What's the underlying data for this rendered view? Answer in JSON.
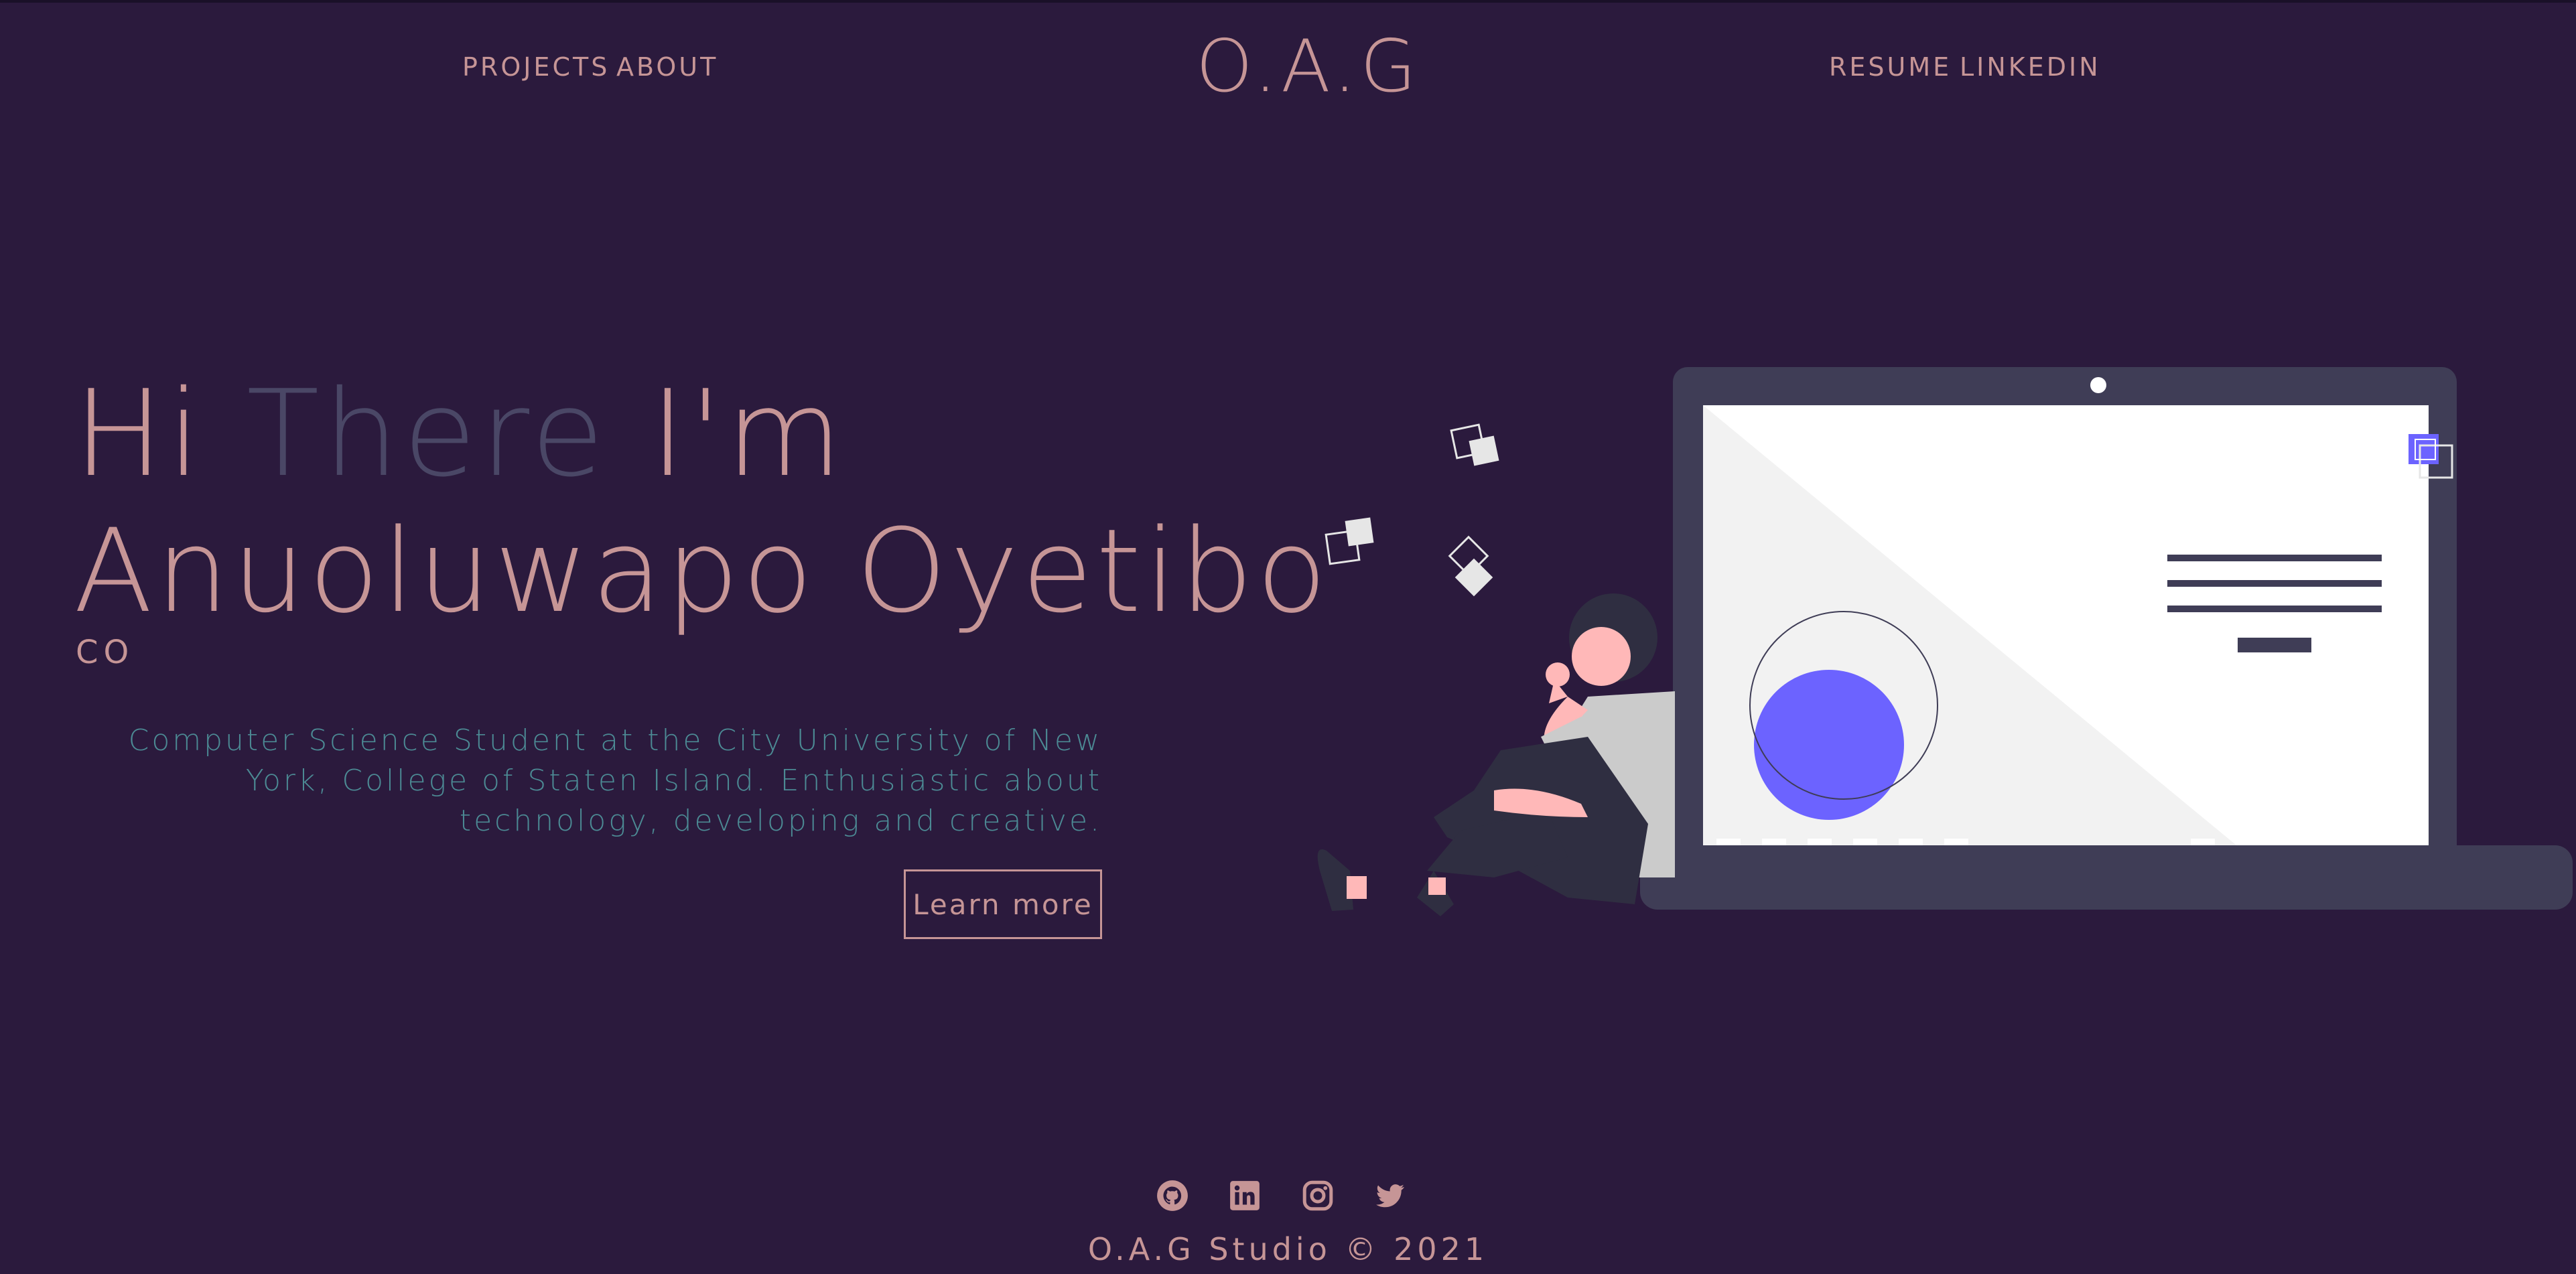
{
  "nav": {
    "left_links": [
      "PROJECTS",
      "ABOUT"
    ],
    "logo": "O.A.G",
    "right_links": [
      "RESUME",
      "LINKEDIN"
    ]
  },
  "hero": {
    "greeting_hi": "Hi",
    "greeting_there": "There",
    "greeting_im": "I'm",
    "name": "Anuoluwapo Oyetibo",
    "typed_text": "CO",
    "bio": "Computer Science Student at the City University of New York, College of Staten Island. Enthusiastic about technology, developing and creative.",
    "cta_label": "Learn more"
  },
  "footer": {
    "social_icons": [
      "github-icon",
      "linkedin-icon",
      "instagram-icon",
      "twitter-icon"
    ],
    "copyright": "O.A.G Studio © 2021"
  },
  "colors": {
    "background": "#2b1a3d",
    "accent_pink": "#c69596",
    "muted_purple": "#4a4766",
    "teal_text": "#4c8a94",
    "laptop_body": "#3f3d56",
    "accent_violet": "#6c63ff"
  }
}
